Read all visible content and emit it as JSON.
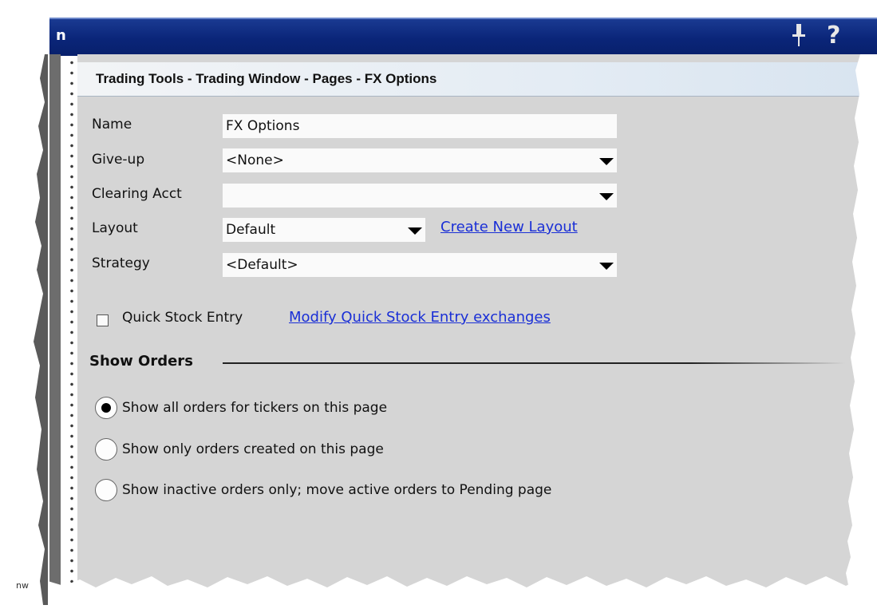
{
  "window": {
    "title_fragment": "n",
    "left_fragment": "nw"
  },
  "breadcrumb": "Trading Tools - Trading Window - Pages - FX Options",
  "form": {
    "name_label": "Name",
    "name_value": "FX Options",
    "giveup_label": "Give-up",
    "giveup_value": "<None>",
    "clearing_label": "Clearing Acct",
    "clearing_value": "",
    "layout_label": "Layout",
    "layout_value": "Default",
    "create_layout_link": "Create New Layout",
    "strategy_label": "Strategy",
    "strategy_value": "<Default>"
  },
  "quick_stock": {
    "checked": false,
    "label": "Quick Stock Entry",
    "link": "Modify Quick Stock Entry exchanges"
  },
  "show_orders": {
    "heading": "Show Orders",
    "options": [
      {
        "label": "Show all orders for tickers on this page",
        "selected": true
      },
      {
        "label": "Show only orders created on this page",
        "selected": false
      },
      {
        "label": "Show inactive orders only; move active orders to Pending page",
        "selected": false
      }
    ]
  },
  "colors": {
    "titlebar": "#0a2578",
    "panel": "#d5d5d5",
    "link": "#1a2fd6"
  },
  "icons": [
    "pin-icon",
    "help-icon",
    "close-icon",
    "chevron-down-icon",
    "checkbox-icon",
    "radio-icon"
  ]
}
